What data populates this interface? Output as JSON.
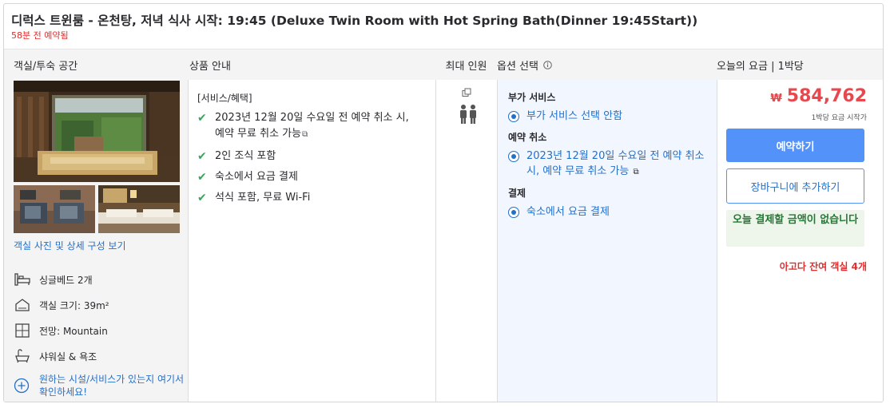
{
  "header": {
    "room_title": "디럭스 트윈룸 - 온천탕, 저녁 식사 시작: 19:45 (Deluxe Twin Room with Hot Spring Bath(Dinner 19:45Start))",
    "booked_note": "58분 전 예약됨"
  },
  "columns": {
    "room": "객실/투숙 공간",
    "benefits": "상품 안내",
    "occupancy": "최대 인원",
    "options": "옵션 선택",
    "options_info_icon": "info-icon",
    "price": "오늘의 요금 | 1박당"
  },
  "room": {
    "photos_link": "객실 사진 및 상세 구성 보기",
    "features": [
      {
        "icon": "bed-icon",
        "label": "싱글베드 2개"
      },
      {
        "icon": "house-size-icon",
        "label": "객실 크기: 39m²"
      },
      {
        "icon": "window-view-icon",
        "label": "전망: Mountain"
      },
      {
        "icon": "bathtub-icon",
        "label": "샤워실 & 욕조"
      }
    ],
    "facilities_link": "원하는 시설/서비스가 있는지 여기서 확인하세요!"
  },
  "benefits": {
    "heading": "[서비스/혜택]",
    "items": [
      "2023년 12월 20일 수요일 전 예약 취소 시, 예약 무료 취소 가능",
      "2인 조식 포함",
      "숙소에서 요금 결제",
      "석식 포함, 무료 Wi-Fi"
    ]
  },
  "occupancy": {
    "icon": "two-adults-icon",
    "copy_icon": "copy-icon"
  },
  "options": {
    "addon_heading": "부가 서비스",
    "addon_choice": "부가 서비스 선택 안함",
    "cancel_heading": "예약 취소",
    "cancel_choice": "2023년 12월 20일 수요일 전 예약 취소 시, 예약 무료 취소 가능",
    "payment_heading": "결제",
    "payment_choice": "숙소에서 요금 결제"
  },
  "price": {
    "currency": "₩",
    "amount": "584,762",
    "per_night": "1박당 요금 시작가",
    "book_label": "예약하기",
    "cart_label": "장바구니에 추가하기",
    "pay_note": "오늘 결제할 금액이 없습니다",
    "rooms_left": "아고다 잔여 객실 4개"
  },
  "colors": {
    "accent": "#5392f9",
    "link": "#2470c9",
    "price_red": "#e8484d",
    "success_green": "#3ba55c"
  }
}
